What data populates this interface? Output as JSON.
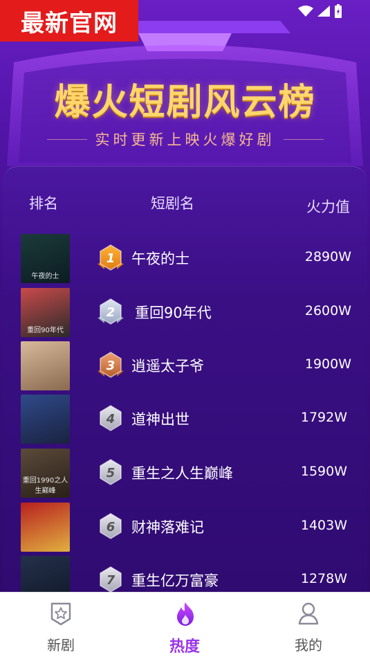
{
  "watermark": "最新官网",
  "banner": {
    "title": "爆火短剧风云榜",
    "subtitle": "实时更新上映火爆好剧"
  },
  "table": {
    "col_rank": "排名",
    "col_name": "短剧名",
    "col_heat": "火力值",
    "rows": [
      {
        "rank": "1",
        "name": "午夜的士",
        "heat": "2890W",
        "cover_text": "午夜的士",
        "medal": "gold"
      },
      {
        "rank": "2",
        "name": "重回90年代",
        "heat": "2600W",
        "cover_text": "重回90年代",
        "medal": "silver"
      },
      {
        "rank": "3",
        "name": "逍遥太子爷",
        "heat": "1900W",
        "cover_text": "",
        "medal": "bronze"
      },
      {
        "rank": "4",
        "name": "道神出世",
        "heat": "1792W",
        "cover_text": "",
        "medal": "grey"
      },
      {
        "rank": "5",
        "name": "重生之人生巅峰",
        "heat": "1590W",
        "cover_text": "重回1990之人生巅峰",
        "medal": "grey"
      },
      {
        "rank": "6",
        "name": "财神落难记",
        "heat": "1403W",
        "cover_text": "",
        "medal": "grey"
      },
      {
        "rank": "7",
        "name": "重生亿万富豪",
        "heat": "1278W",
        "cover_text": "",
        "medal": "grey"
      }
    ]
  },
  "tabbar": {
    "items": [
      {
        "label": "新剧",
        "icon": "star-shield-icon",
        "active": false
      },
      {
        "label": "热度",
        "icon": "flame-icon",
        "active": true
      },
      {
        "label": "我的",
        "icon": "user-icon",
        "active": false
      }
    ]
  },
  "colors": {
    "accent": "#9b35e8",
    "gold": "#ffd66b",
    "panel": "#3a0f84"
  }
}
